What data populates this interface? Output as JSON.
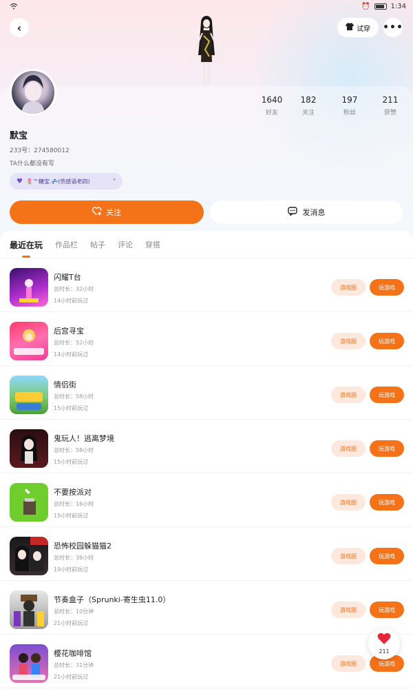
{
  "status_bar": {
    "time": "1:34"
  },
  "header": {
    "tryon_label": "试穿",
    "colors": {
      "accent": "#f47218",
      "accent_light": "#fde8de"
    }
  },
  "profile": {
    "name": "默宝",
    "uid": "233号：274580012",
    "bio": "TA什么都没有写",
    "tag": "🌷™糖宝.💤(伤感语老四)",
    "stats": [
      {
        "num": "1640",
        "label": "好友"
      },
      {
        "num": "182",
        "label": "关注"
      },
      {
        "num": "197",
        "label": "粉丝"
      },
      {
        "num": "211",
        "label": "获赞"
      }
    ],
    "follow_label": "关注",
    "message_label": "发消息"
  },
  "tabs": [
    {
      "label": "最近在玩",
      "active": true
    },
    {
      "label": "作品栏",
      "active": false
    },
    {
      "label": "帖子",
      "active": false
    },
    {
      "label": "评论",
      "active": false
    },
    {
      "label": "穿搭",
      "active": false
    }
  ],
  "buttons": {
    "circle": "游戏圈",
    "play": "玩游戏"
  },
  "games": [
    {
      "title": "闪耀T台",
      "duration": "总时长：32小时",
      "last": "14小时前玩过"
    },
    {
      "title": "后宫寻宝",
      "duration": "总时长：52小时",
      "last": "14小时前玩过"
    },
    {
      "title": "情侣街",
      "duration": "总时长：58小时",
      "last": "15小时前玩过"
    },
    {
      "title": "鬼玩人！逃离梦境",
      "duration": "总时长：58小时",
      "last": "15小时前玩过"
    },
    {
      "title": "不要按派对",
      "duration": "总时长：16小时",
      "last": "15小时前玩过"
    },
    {
      "title": "恐怖校园躲猫猫2",
      "duration": "总时长：36小时",
      "last": "19小时前玩过"
    },
    {
      "title": "节奏盒子（Sprunki-寄生虫11.0）",
      "duration": "总时长：10分钟",
      "last": "21小时前玩过"
    },
    {
      "title": "樱花咖啡馆",
      "duration": "总时长：31分钟",
      "last": "21小时前玩过"
    }
  ],
  "float_like": {
    "count": "211"
  }
}
